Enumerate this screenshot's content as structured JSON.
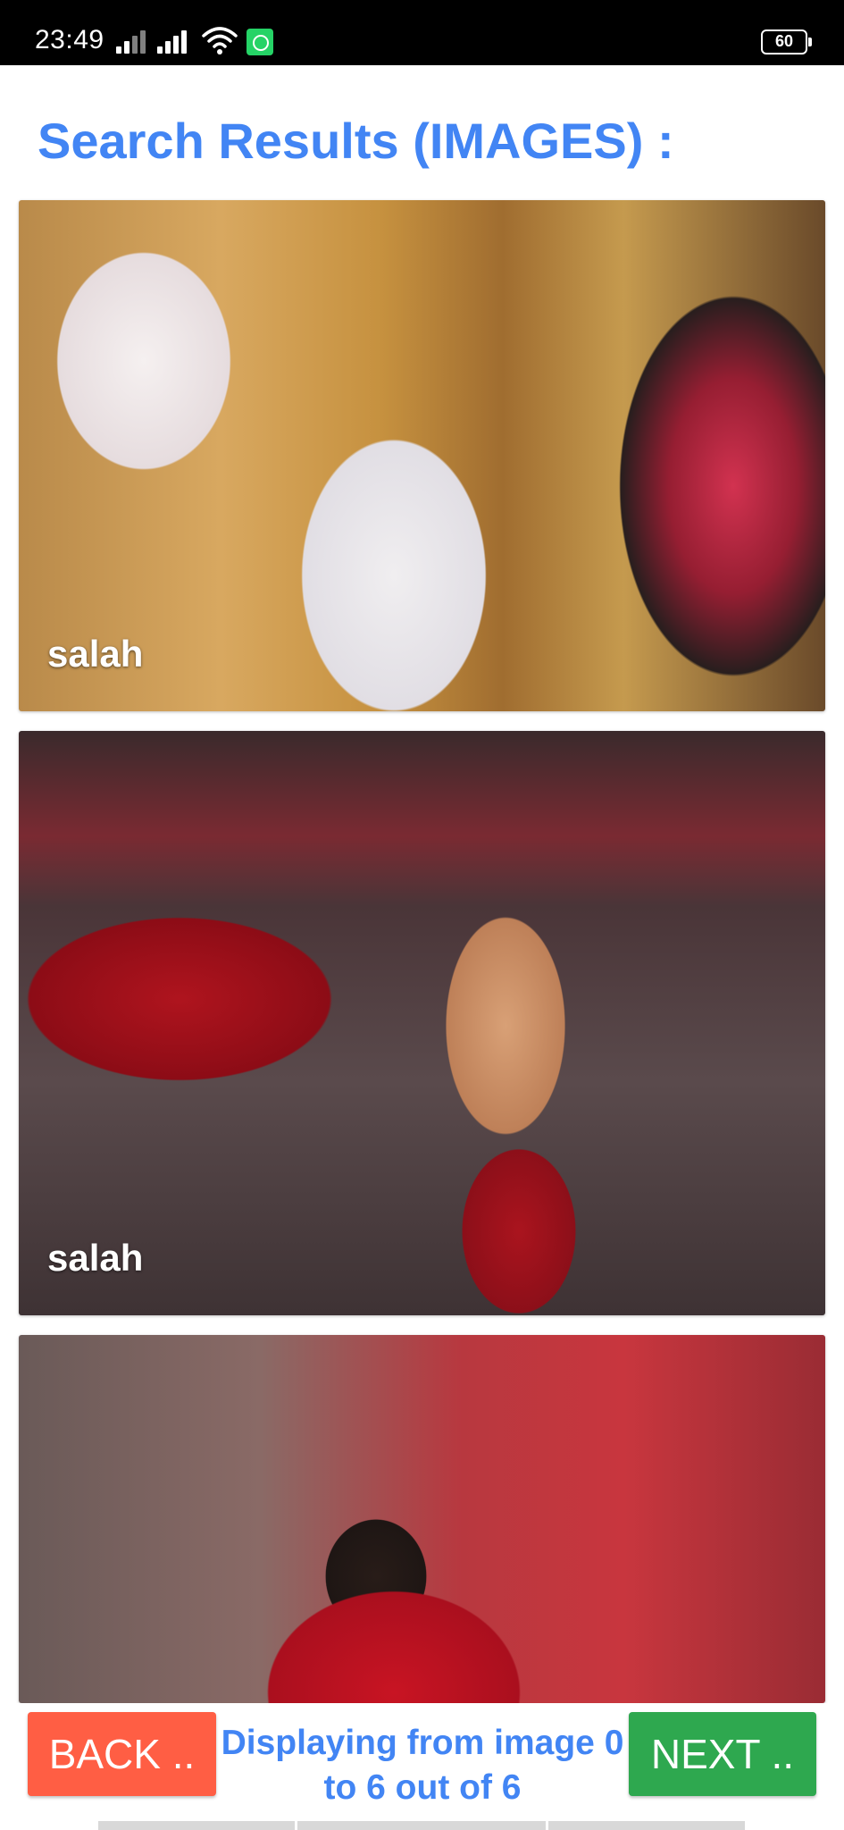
{
  "status_bar": {
    "time": "23:49",
    "battery": "60",
    "icons": [
      "signal-icon",
      "signal-icon",
      "wifi-icon",
      "whatsapp-icon",
      "battery-icon"
    ]
  },
  "header": {
    "title": "Search Results (IMAGES) :"
  },
  "results": [
    {
      "caption": "salah"
    },
    {
      "caption": "salah"
    },
    {
      "caption": ""
    }
  ],
  "footer": {
    "back_label": "BACK ..",
    "next_label": "NEXT ..",
    "status_text": "Displaying from image 0 to 6 out of 6"
  },
  "colors": {
    "title": "#4285f4",
    "back_button": "#ff5e44",
    "next_button": "#2ea84f"
  }
}
